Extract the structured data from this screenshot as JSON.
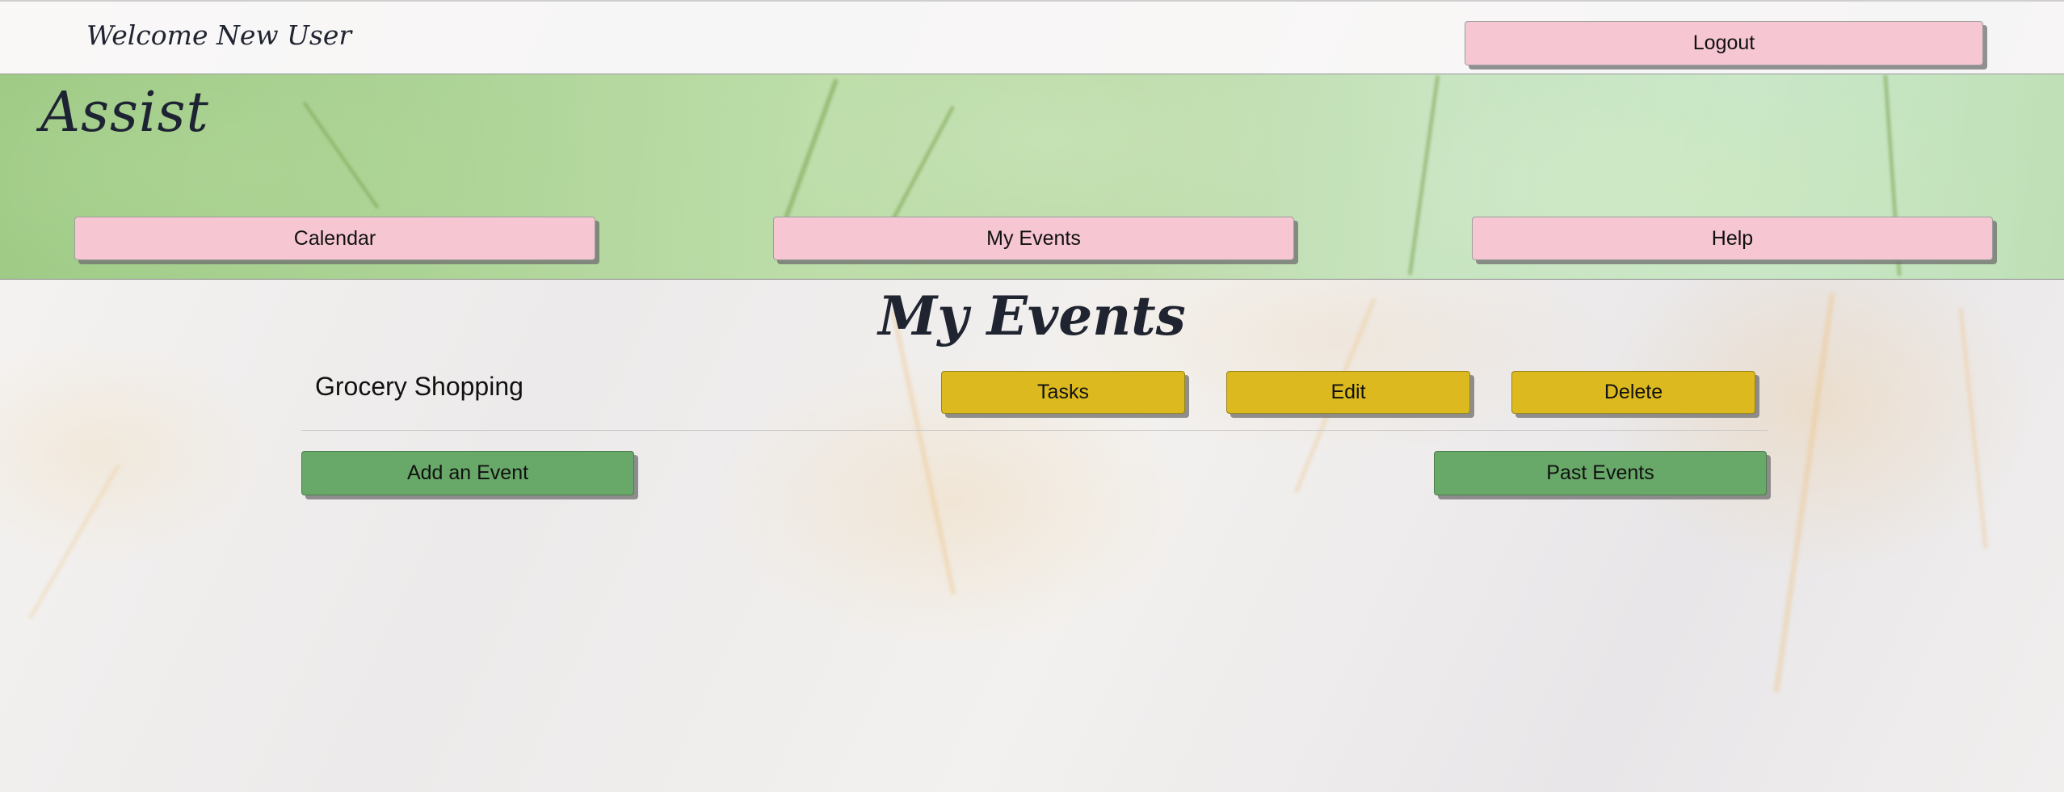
{
  "header": {
    "welcome_text": "Welcome New User",
    "logout_label": "Logout"
  },
  "banner": {
    "logo_text": "Assist",
    "nav": {
      "calendar_label": "Calendar",
      "my_events_label": "My Events",
      "help_label": "Help"
    }
  },
  "main": {
    "title": "My Events",
    "events": [
      {
        "name": "Grocery Shopping",
        "tasks_label": "Tasks",
        "edit_label": "Edit",
        "delete_label": "Delete"
      }
    ],
    "add_event_label": "Add an Event",
    "past_events_label": "Past Events"
  },
  "colors": {
    "nav_button": "#f6c6d3",
    "event_action_button": "#dbb91f",
    "primary_action_button": "#68a868",
    "banner_green": "#a6d08e"
  }
}
